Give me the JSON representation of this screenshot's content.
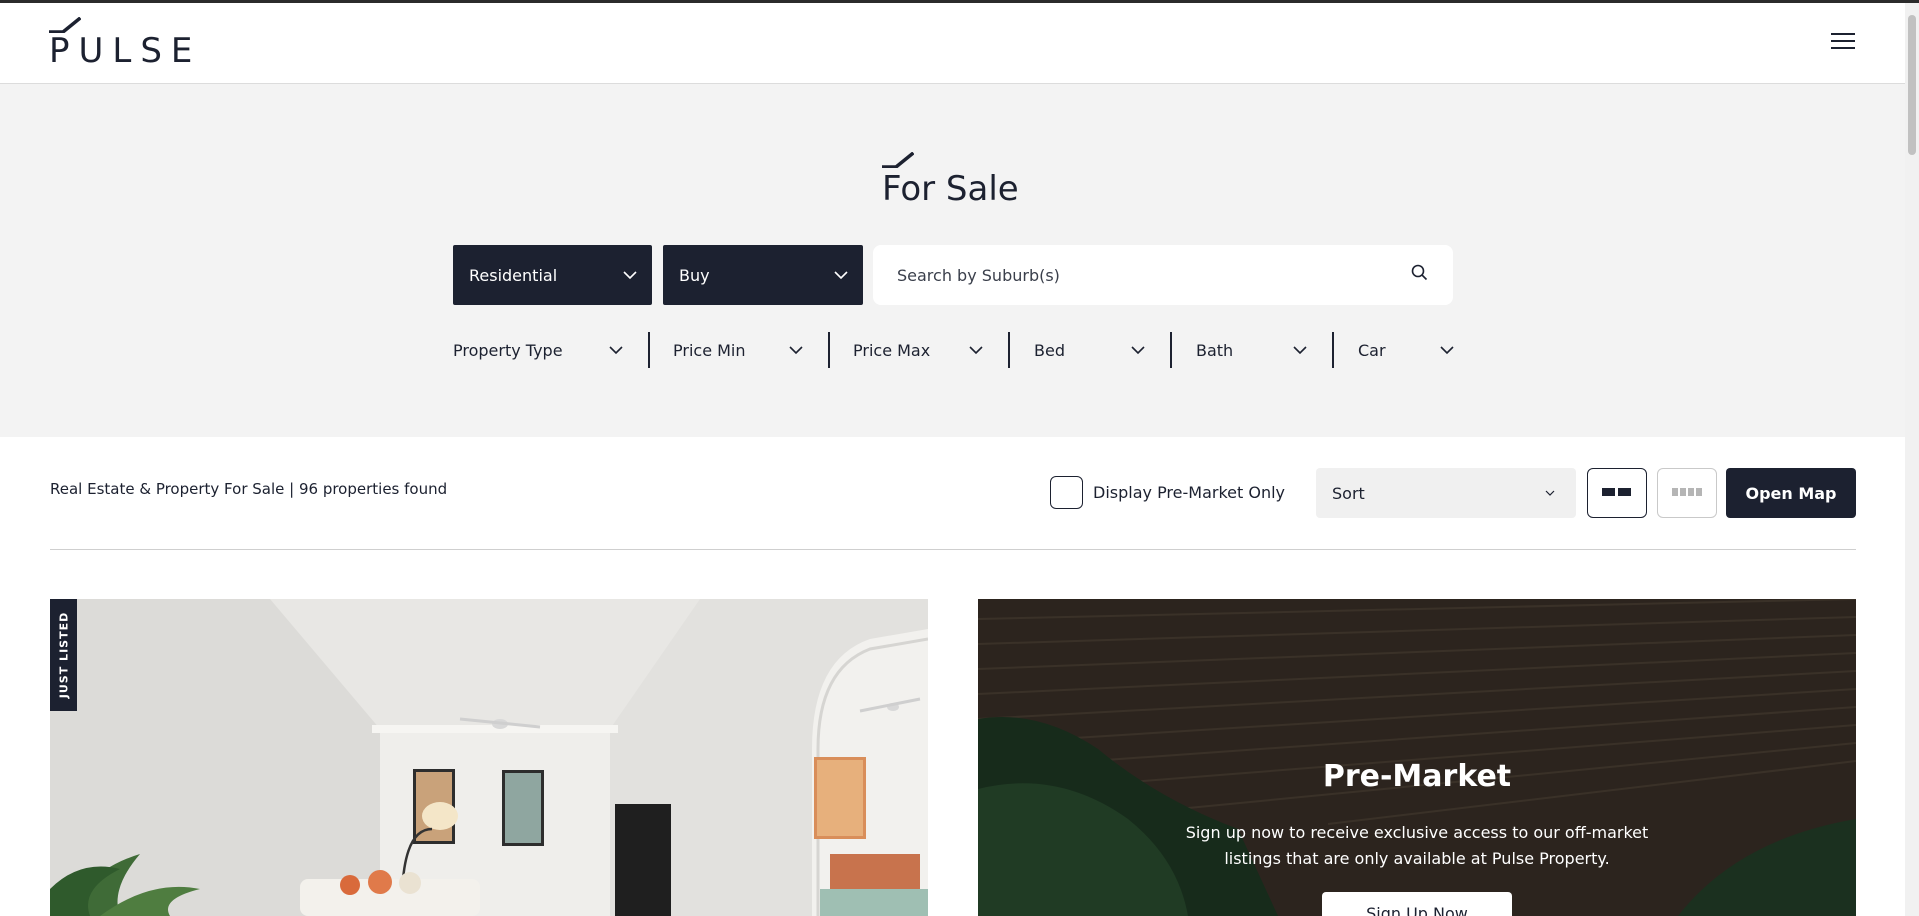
{
  "header": {
    "logo_text": "PULSE",
    "menu_icon": "hamburger-menu-icon"
  },
  "hero": {
    "title": "For Sale",
    "category_dropdown": "Residential",
    "mode_dropdown": "Buy",
    "search_placeholder": "Search by Suburb(s)",
    "filters": [
      "Property Type",
      "Price Min",
      "Price Max",
      "Bed",
      "Bath",
      "Car"
    ]
  },
  "results": {
    "summary": "Real Estate & Property For Sale | 96 properties found",
    "premarket_label": "Display Pre-Market Only",
    "sort_label": "Sort",
    "open_map_label": "Open Map"
  },
  "cards": {
    "listing_badge": "JUST LISTED",
    "premarket_title": "Pre-Market",
    "premarket_desc": "Sign up now to receive exclusive access to our off-market listings that are only available at Pulse Property.",
    "premarket_button": "Sign Up Now"
  },
  "colors": {
    "brand_dark": "#1c2130",
    "hero_bg": "#f3f3f3"
  }
}
